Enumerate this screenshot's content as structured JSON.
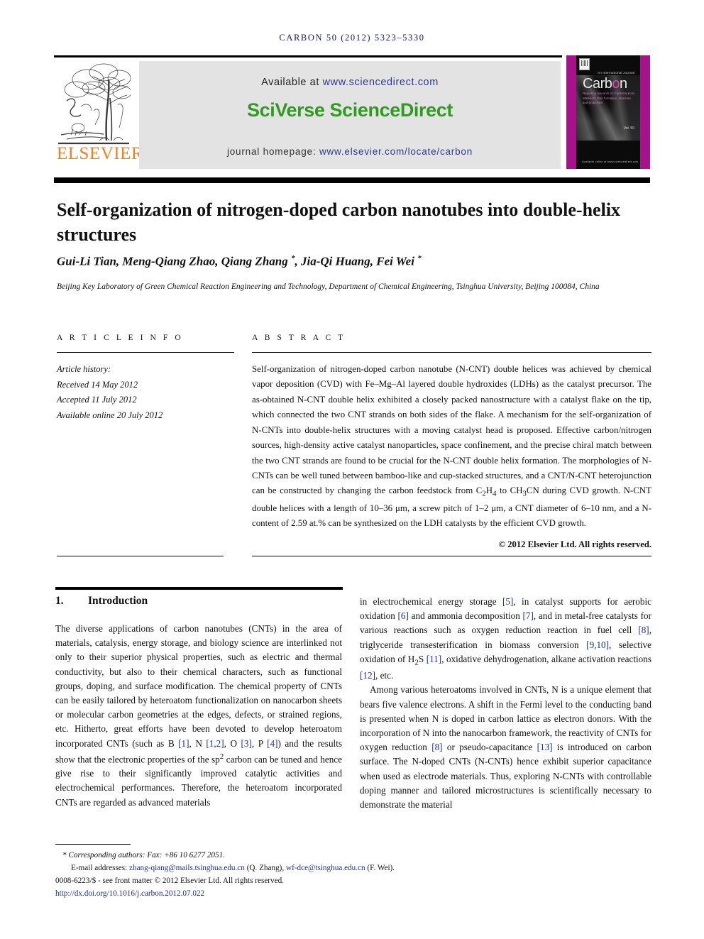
{
  "running_head": "CARBON 50 (2012) 5323–5330",
  "masthead": {
    "available_prefix": "Available at ",
    "available_url": "www.sciencedirect.com",
    "brand": "SciVerse ScienceDirect",
    "homepage_prefix": "journal homepage: ",
    "homepage_url": "www.elsevier.com/locate/carbon",
    "publisher": "ELSEVIER",
    "cover": {
      "supertitle": "An International Journal",
      "title_pre": "Carb",
      "title_o": "o",
      "title_post": "n",
      "subtitle": "Reporting research on Carbonaceous Materials: their formation, structure and properties",
      "volume": "Vol. 50",
      "footer": "Available online at www.sciencedirect.com"
    },
    "colors": {
      "brand_green": "#2f9b20",
      "link_blue": "#2b3a8f",
      "elsevier_orange": "#f08020",
      "cover_magenta": "#a4138a"
    }
  },
  "article": {
    "title": "Self-organization of nitrogen-doped carbon nanotubes into double-helix structures",
    "authors": "Gui-Li Tian, Meng-Qiang Zhao, Qiang Zhang *, Jia-Qi Huang, Fei Wei *",
    "affiliation": "Beijing Key Laboratory of Green Chemical Reaction Engineering and Technology, Department of Chemical Engineering, Tsinghua University, Beijing 100084, China"
  },
  "info": {
    "heading": "A R T I C L E   I N F O",
    "history_label": "Article history:",
    "received": "Received 14 May 2012",
    "accepted": "Accepted 11 July 2012",
    "online": "Available online 20 July 2012"
  },
  "abstract": {
    "heading": "A B S T R A C T",
    "text": "Self-organization of nitrogen-doped carbon nanotube (N-CNT) double helices was achieved by chemical vapor deposition (CVD) with Fe–Mg–Al layered double hydroxides (LDHs) as the catalyst precursor. The as-obtained N-CNT double helix exhibited a closely packed nanostructure with a catalyst flake on the tip, which connected the two CNT strands on both sides of the flake. A mechanism for the self-organization of N-CNTs into double-helix structures with a moving catalyst head is proposed. Effective carbon/nitrogen sources, high-density active catalyst nanoparticles, space confinement, and the precise chiral match between the two CNT strands are found to be crucial for the N-CNT double helix formation. The morphologies of N-CNTs can be well tuned between bamboo-like and cup-stacked structures, and a CNT/N-CNT heterojunction can be constructed by changing the carbon feedstock from C2H4 to CH3CN during CVD growth. N-CNT double helices with a length of 10–36 μm, a screw pitch of 1–2 μm, a CNT diameter of 6–10 nm, and a N-content of 2.59 at.% can be synthesized on the LDH catalysts by the efficient CVD growth.",
    "copyright": "© 2012 Elsevier Ltd. All rights reserved."
  },
  "body": {
    "section_number": "1.",
    "section_title": "Introduction",
    "left_paragraph_1": "The diverse applications of carbon nanotubes (CNTs) in the area of materials, catalysis, energy storage, and biology science are interlinked not only to their superior physical properties, such as electric and thermal conductivity, but also to their chemical characters, such as functional groups, doping, and surface modification. The chemical property of CNTs can be easily tailored by heteroatom functionalization on nanocarbon sheets or molecular carbon geometries at the edges, defects, or strained regions, etc. Hitherto, great efforts have been devoted to develop heteroatom incorporated CNTs (such as B [1], N [1,2], O [3], P [4]) and the results show that the electronic properties of the sp2 carbon can be tuned and hence give rise to their significantly improved catalytic activities and electrochemical performances. Therefore, the heteroatom incorporated CNTs are regarded as advanced materials",
    "right_paragraph_1": "in electrochemical energy storage [5], in catalyst supports for aerobic oxidation [6] and ammonia decomposition [7], and in metal-free catalysts for various reactions such as oxygen reduction reaction in fuel cell [8], triglyceride transesterification in biomass conversion [9,10], selective oxidation of H2S [11], oxidative dehydrogenation, alkane activation reactions [12], etc.",
    "right_paragraph_2": "Among various heteroatoms involved in CNTs, N is a unique element that bears five valence electrons. A shift in the Fermi level to the conducting band is presented when N is doped in carbon lattice as electron donors. With the incorporation of N into the nanocarbon framework, the reactivity of CNTs for oxygen reduction [8] or pseudo-capacitance [13] is introduced on carbon surface. The N-doped CNTs (N-CNTs) hence exhibit superior capacitance when used as electrode materials. Thus, exploring N-CNTs with controllable doping manner and tailored microstructures is scientifically necessary to demonstrate the material"
  },
  "footnotes": {
    "corresponding": "* Corresponding authors: Fax: +86 10 6277 2051.",
    "email_label": "E-mail addresses: ",
    "email_1": "zhang-qiang@mails.tsinghua.edu.cn",
    "email_1_owner": " (Q. Zhang), ",
    "email_2": "wf-dce@tsinghua.edu.cn",
    "email_2_owner": " (F. Wei).",
    "issn_line": "0008-6223/$ - see front matter © 2012 Elsevier Ltd. All rights reserved.",
    "doi": "http://dx.doi.org/10.1016/j.carbon.2012.07.022"
  }
}
